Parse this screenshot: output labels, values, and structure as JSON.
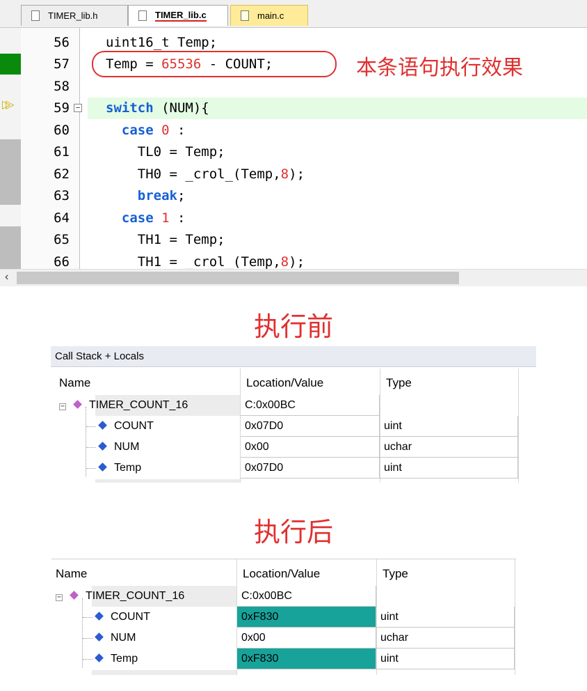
{
  "tabs": [
    {
      "label": "TIMER_lib.h"
    },
    {
      "label": "TIMER_lib.c"
    },
    {
      "label": "main.c"
    }
  ],
  "code_lines": [
    {
      "n": "56",
      "text": "uint16_t Temp;"
    },
    {
      "n": "57",
      "text": "Temp = 65536 - COUNT;"
    },
    {
      "n": "58",
      "text": ""
    },
    {
      "n": "59",
      "text": "switch (NUM){"
    },
    {
      "n": "60",
      "text": "  case 0 :"
    },
    {
      "n": "61",
      "text": "    TL0 = Temp;"
    },
    {
      "n": "62",
      "text": "    TH0 = _crol_(Temp,8);"
    },
    {
      "n": "63",
      "text": "    break;"
    },
    {
      "n": "64",
      "text": "  case 1 :"
    },
    {
      "n": "65",
      "text": "    TH1 = Temp;"
    },
    {
      "n": "66",
      "text": "    TH1 = _crol_(Temp,8);"
    }
  ],
  "annotation": "本条语句执行效果",
  "before": {
    "caption": "执行前",
    "panel_title": "Call Stack + Locals",
    "headers": {
      "name": "Name",
      "value": "Location/Value",
      "type": "Type"
    },
    "func": {
      "name": "TIMER_COUNT_16",
      "value": "C:0x00BC"
    },
    "vars": [
      {
        "name": "COUNT",
        "value": "0x07D0",
        "type": "uint"
      },
      {
        "name": "NUM",
        "value": "0x00",
        "type": "uchar"
      },
      {
        "name": "Temp",
        "value": "0x07D0",
        "type": "uint"
      }
    ]
  },
  "after": {
    "caption": "执行后",
    "headers": {
      "name": "Name",
      "value": "Location/Value",
      "type": "Type"
    },
    "func": {
      "name": "TIMER_COUNT_16",
      "value": "C:0x00BC"
    },
    "vars": [
      {
        "name": "COUNT",
        "value": "0xF830",
        "type": "uint",
        "changed": true
      },
      {
        "name": "NUM",
        "value": "0x00",
        "type": "uchar",
        "changed": false
      },
      {
        "name": "Temp",
        "value": "0xF830",
        "type": "uint",
        "changed": true
      }
    ]
  },
  "colors": {
    "changed_highlight": "#17a39a",
    "annotation": "#e03030",
    "keyword": "#1560d4",
    "number": "#e03030"
  }
}
